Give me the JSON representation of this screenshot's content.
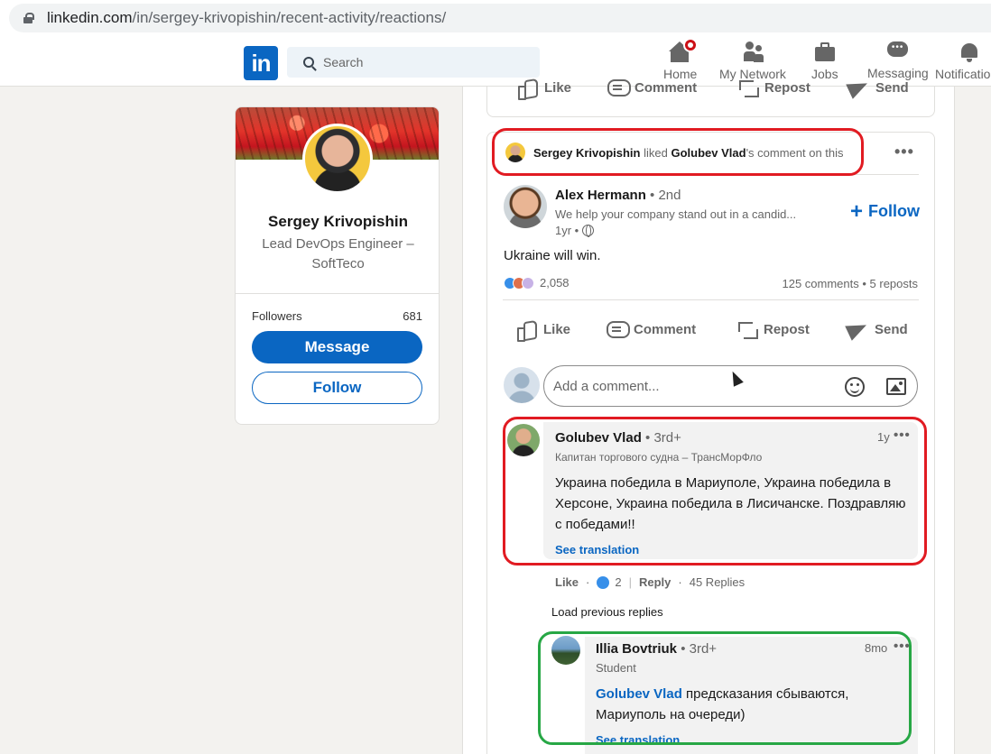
{
  "browser": {
    "url_host": "linkedin.com",
    "url_path": "/in/sergey-krivopishin/recent-activity/reactions/"
  },
  "nav": {
    "logo": "in",
    "search_placeholder": "Search",
    "items": [
      {
        "label": "Home",
        "icon": "home-icon"
      },
      {
        "label": "My Network",
        "icon": "network-icon"
      },
      {
        "label": "Jobs",
        "icon": "jobs-icon"
      },
      {
        "label": "Messaging",
        "icon": "messaging-icon"
      },
      {
        "label": "Notifications",
        "icon": "bell-icon"
      }
    ]
  },
  "profile": {
    "name": "Sergey Krivopishin",
    "headline": "Lead DevOps Engineer – SoftTeco",
    "followers_label": "Followers",
    "followers_count": "681",
    "message_label": "Message",
    "follow_label": "Follow"
  },
  "actions": {
    "like": "Like",
    "comment": "Comment",
    "repost": "Repost",
    "send": "Send"
  },
  "activity": {
    "actor": "Sergey Krivopishin",
    "verb": "liked",
    "target": "Golubev Vlad",
    "suffix": "'s comment on this",
    "more": "•••"
  },
  "post": {
    "author": "Alex Hermann",
    "degree": "• 2nd",
    "headline": "We help your company stand out in a candid...",
    "time": "1yr •",
    "follow_label": "Follow",
    "text": "Ukraine will win.",
    "reaction_count": "2,058",
    "stats": "125 comments • 5 reposts",
    "comment_placeholder": "Add a comment..."
  },
  "comment": {
    "name": "Golubev Vlad",
    "degree": "• 3rd+",
    "headline": "Капитан торгового судна – ТрансМорФло",
    "time": "1y",
    "more": "•••",
    "text": "Украина победила в Мариуполе, Украина победила в Херсоне, Украина победила в Лисичанске. Поздравляю с победами!!",
    "see_translation": "See translation",
    "like": "Like",
    "like_count": "2",
    "reply": "Reply",
    "replies": "45 Replies",
    "load_previous": "Load previous replies"
  },
  "reply": {
    "name": "Illia Bovtriuk",
    "degree": "• 3rd+",
    "headline": "Student",
    "time": "8mo",
    "more": "•••",
    "mention": "Golubev Vlad",
    "text": " предсказания сбываются, Мариуполь на очереди)",
    "see_translation": "See translation"
  },
  "colors": {
    "brand": "#0a66c2",
    "annotation_red": "#e11b22",
    "annotation_green": "#27a745"
  }
}
